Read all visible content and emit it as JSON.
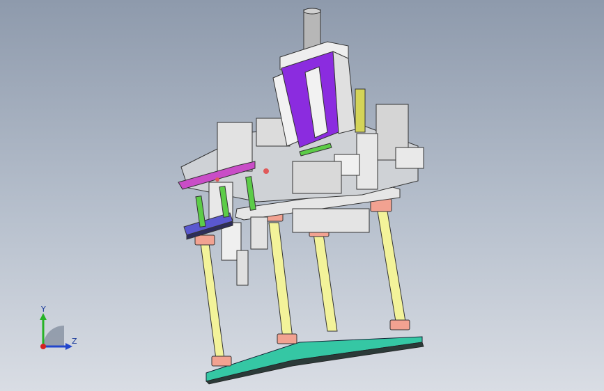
{
  "triad": {
    "y_label": "Y",
    "z_label": "Z"
  },
  "colors": {
    "viewport_top": "#8e9aac",
    "viewport_bottom": "#d9dde4",
    "purple": "#8a2be2",
    "magenta": "#cc44cc",
    "blue_plate": "#5555cc",
    "green": "#55cc44",
    "yellow": "#eaea7a",
    "teal": "#33ccaa",
    "salmon": "#f0a090",
    "metal": "#d8d8d8",
    "olive": "#cccc55"
  },
  "icons": {
    "triad": "coordinate-triad-icon"
  }
}
